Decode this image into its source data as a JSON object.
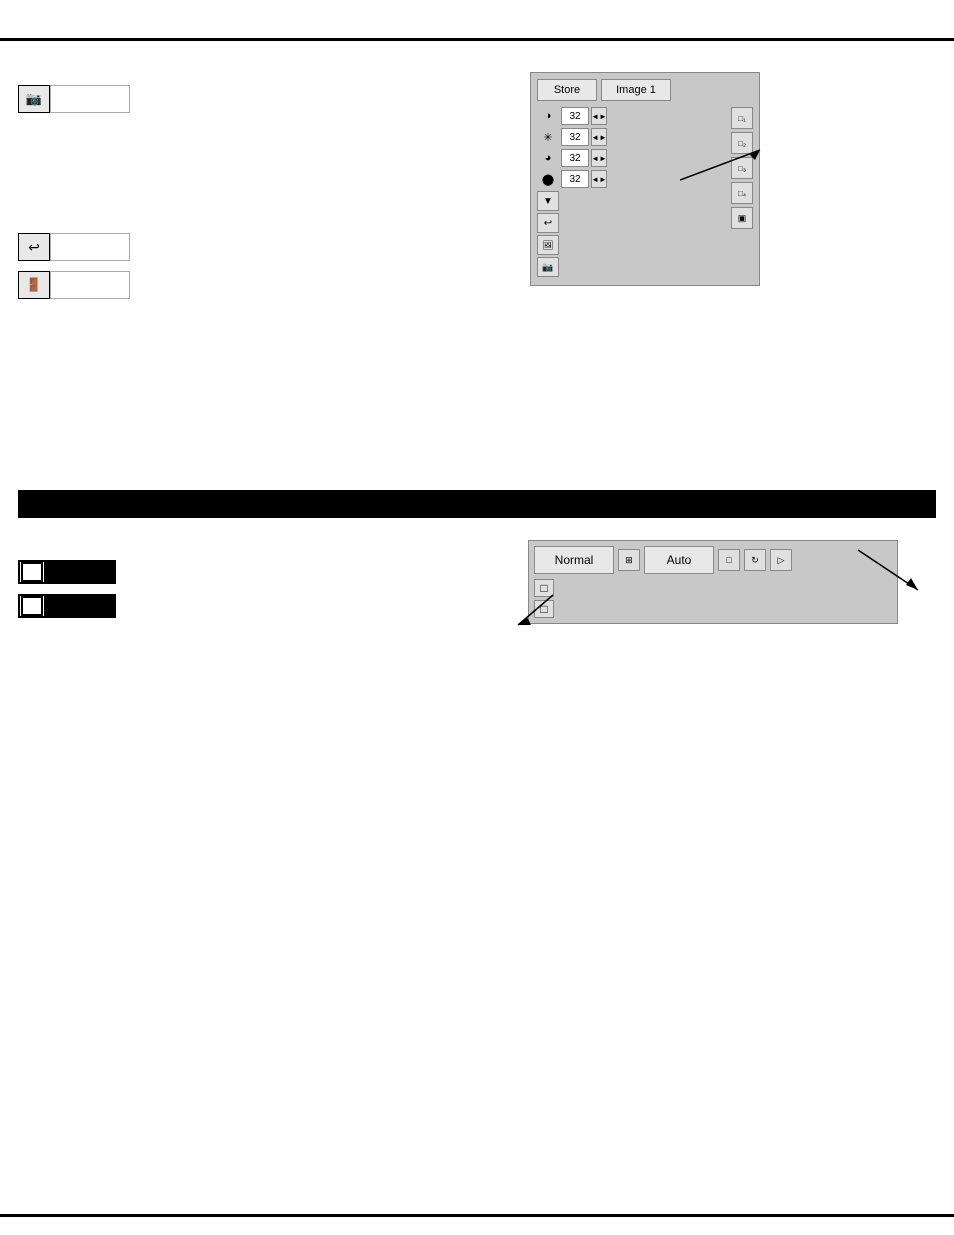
{
  "top_border": "border",
  "bottom_border": "border",
  "section_divider": "divider",
  "upper_section": {
    "icon_buttons": [
      {
        "id": "camera-btn",
        "icon": "📷",
        "label": ""
      },
      {
        "id": "undo-btn",
        "icon": "↩",
        "label": ""
      },
      {
        "id": "door-btn",
        "icon": "🚪",
        "label": ""
      }
    ]
  },
  "upper_right_panel": {
    "store_label": "Store",
    "image_label": "Image 1",
    "controls": [
      {
        "icon": "◑",
        "value": "32"
      },
      {
        "icon": "✳",
        "value": "32"
      },
      {
        "icon": "◕",
        "value": "32"
      },
      {
        "icon": "⬤",
        "value": "32"
      }
    ],
    "right_buttons": [
      "□1",
      "□2",
      "□3",
      "□4",
      "▣"
    ],
    "bottom_icons": [
      "▼",
      "↩",
      "🖻",
      "▣"
    ]
  },
  "lower_section": {
    "left_items": [
      {
        "id": "item1",
        "label": ""
      },
      {
        "id": "item2",
        "label": ""
      }
    ],
    "right_panel": {
      "normal_label": "Normal",
      "auto_label": "Auto",
      "items": [
        "□",
        "□"
      ]
    }
  }
}
